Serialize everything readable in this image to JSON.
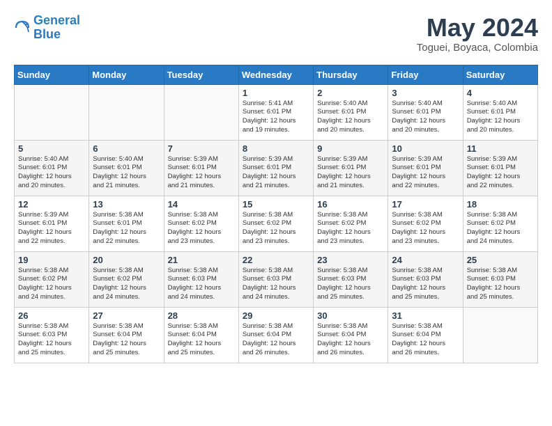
{
  "header": {
    "logo_line1": "General",
    "logo_line2": "Blue",
    "month_year": "May 2024",
    "location": "Toguei, Boyaca, Colombia"
  },
  "days_of_week": [
    "Sunday",
    "Monday",
    "Tuesday",
    "Wednesday",
    "Thursday",
    "Friday",
    "Saturday"
  ],
  "weeks": [
    [
      {
        "day": "",
        "info": ""
      },
      {
        "day": "",
        "info": ""
      },
      {
        "day": "",
        "info": ""
      },
      {
        "day": "1",
        "info": "Sunrise: 5:41 AM\nSunset: 6:01 PM\nDaylight: 12 hours\nand 19 minutes."
      },
      {
        "day": "2",
        "info": "Sunrise: 5:40 AM\nSunset: 6:01 PM\nDaylight: 12 hours\nand 20 minutes."
      },
      {
        "day": "3",
        "info": "Sunrise: 5:40 AM\nSunset: 6:01 PM\nDaylight: 12 hours\nand 20 minutes."
      },
      {
        "day": "4",
        "info": "Sunrise: 5:40 AM\nSunset: 6:01 PM\nDaylight: 12 hours\nand 20 minutes."
      }
    ],
    [
      {
        "day": "5",
        "info": "Sunrise: 5:40 AM\nSunset: 6:01 PM\nDaylight: 12 hours\nand 20 minutes."
      },
      {
        "day": "6",
        "info": "Sunrise: 5:40 AM\nSunset: 6:01 PM\nDaylight: 12 hours\nand 21 minutes."
      },
      {
        "day": "7",
        "info": "Sunrise: 5:39 AM\nSunset: 6:01 PM\nDaylight: 12 hours\nand 21 minutes."
      },
      {
        "day": "8",
        "info": "Sunrise: 5:39 AM\nSunset: 6:01 PM\nDaylight: 12 hours\nand 21 minutes."
      },
      {
        "day": "9",
        "info": "Sunrise: 5:39 AM\nSunset: 6:01 PM\nDaylight: 12 hours\nand 21 minutes."
      },
      {
        "day": "10",
        "info": "Sunrise: 5:39 AM\nSunset: 6:01 PM\nDaylight: 12 hours\nand 22 minutes."
      },
      {
        "day": "11",
        "info": "Sunrise: 5:39 AM\nSunset: 6:01 PM\nDaylight: 12 hours\nand 22 minutes."
      }
    ],
    [
      {
        "day": "12",
        "info": "Sunrise: 5:39 AM\nSunset: 6:01 PM\nDaylight: 12 hours\nand 22 minutes."
      },
      {
        "day": "13",
        "info": "Sunrise: 5:38 AM\nSunset: 6:01 PM\nDaylight: 12 hours\nand 22 minutes."
      },
      {
        "day": "14",
        "info": "Sunrise: 5:38 AM\nSunset: 6:02 PM\nDaylight: 12 hours\nand 23 minutes."
      },
      {
        "day": "15",
        "info": "Sunrise: 5:38 AM\nSunset: 6:02 PM\nDaylight: 12 hours\nand 23 minutes."
      },
      {
        "day": "16",
        "info": "Sunrise: 5:38 AM\nSunset: 6:02 PM\nDaylight: 12 hours\nand 23 minutes."
      },
      {
        "day": "17",
        "info": "Sunrise: 5:38 AM\nSunset: 6:02 PM\nDaylight: 12 hours\nand 23 minutes."
      },
      {
        "day": "18",
        "info": "Sunrise: 5:38 AM\nSunset: 6:02 PM\nDaylight: 12 hours\nand 24 minutes."
      }
    ],
    [
      {
        "day": "19",
        "info": "Sunrise: 5:38 AM\nSunset: 6:02 PM\nDaylight: 12 hours\nand 24 minutes."
      },
      {
        "day": "20",
        "info": "Sunrise: 5:38 AM\nSunset: 6:02 PM\nDaylight: 12 hours\nand 24 minutes."
      },
      {
        "day": "21",
        "info": "Sunrise: 5:38 AM\nSunset: 6:03 PM\nDaylight: 12 hours\nand 24 minutes."
      },
      {
        "day": "22",
        "info": "Sunrise: 5:38 AM\nSunset: 6:03 PM\nDaylight: 12 hours\nand 24 minutes."
      },
      {
        "day": "23",
        "info": "Sunrise: 5:38 AM\nSunset: 6:03 PM\nDaylight: 12 hours\nand 25 minutes."
      },
      {
        "day": "24",
        "info": "Sunrise: 5:38 AM\nSunset: 6:03 PM\nDaylight: 12 hours\nand 25 minutes."
      },
      {
        "day": "25",
        "info": "Sunrise: 5:38 AM\nSunset: 6:03 PM\nDaylight: 12 hours\nand 25 minutes."
      }
    ],
    [
      {
        "day": "26",
        "info": "Sunrise: 5:38 AM\nSunset: 6:03 PM\nDaylight: 12 hours\nand 25 minutes."
      },
      {
        "day": "27",
        "info": "Sunrise: 5:38 AM\nSunset: 6:04 PM\nDaylight: 12 hours\nand 25 minutes."
      },
      {
        "day": "28",
        "info": "Sunrise: 5:38 AM\nSunset: 6:04 PM\nDaylight: 12 hours\nand 25 minutes."
      },
      {
        "day": "29",
        "info": "Sunrise: 5:38 AM\nSunset: 6:04 PM\nDaylight: 12 hours\nand 26 minutes."
      },
      {
        "day": "30",
        "info": "Sunrise: 5:38 AM\nSunset: 6:04 PM\nDaylight: 12 hours\nand 26 minutes."
      },
      {
        "day": "31",
        "info": "Sunrise: 5:38 AM\nSunset: 6:04 PM\nDaylight: 12 hours\nand 26 minutes."
      },
      {
        "day": "",
        "info": ""
      }
    ]
  ]
}
